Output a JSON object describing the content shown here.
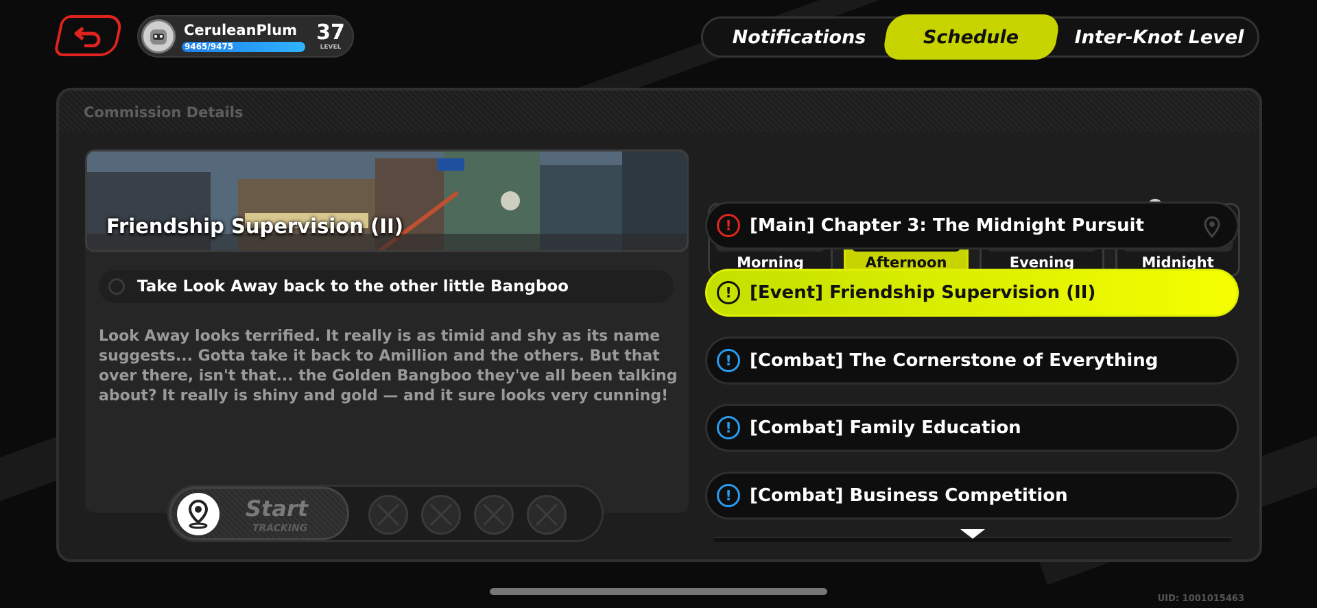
{
  "player": {
    "name": "CeruleanPlum",
    "xp_text": "9465/9475",
    "xp_fraction": 0.9989,
    "level": "37",
    "level_label": "LEVEL"
  },
  "tabs": [
    {
      "label": "Notifications"
    },
    {
      "label": "Schedule",
      "active": true
    },
    {
      "label": "Inter-Knot Level"
    }
  ],
  "panel": {
    "title": "Commission Details"
  },
  "detail": {
    "banner_title": "Friendship Supervision (II)",
    "objective": "Take Look Away back to the other little Bangboo",
    "description": "Look Away looks terrified. It really is as timid and shy as its name suggests... Gotta take it back to Amillion and the others. But that over there, isn't that... the Golden Bangboo they've all been talking about? It really is shiny and gold — and it sure looks very cunning!"
  },
  "tracking": {
    "start_label": "Start",
    "start_sub": "TRACKING"
  },
  "times": [
    {
      "label": "Morning",
      "icon": "morning-sun-cloud-icon",
      "color": "#f2d64b"
    },
    {
      "label": "Afternoon",
      "icon": "afternoon-sun-icon",
      "color": "#f0a020",
      "active": true
    },
    {
      "label": "Evening",
      "icon": "evening-moon-icon",
      "color": "#38b8f0"
    },
    {
      "label": "Midnight",
      "icon": "midnight-moon-cloud-icon",
      "color": "#7a5cf0"
    }
  ],
  "commissions": [
    {
      "text": "[Main] Chapter 3: The Midnight Pursuit",
      "badge": "red",
      "pinned": true
    },
    {
      "text": "[Event] Friendship Supervision (II)",
      "badge": "dark",
      "active": true
    },
    {
      "text": "[Combat] The Cornerstone of Everything",
      "badge": "blue"
    },
    {
      "text": "[Combat] Family Education",
      "badge": "blue"
    },
    {
      "text": "[Combat] Business Competition",
      "badge": "blue"
    }
  ],
  "uid": "UID: 1001015463",
  "colors": {
    "accent_yellow": "#c8d400",
    "back_red": "#e0231e",
    "main_red": "#e0261e",
    "combat_blue": "#2a9cf0"
  }
}
